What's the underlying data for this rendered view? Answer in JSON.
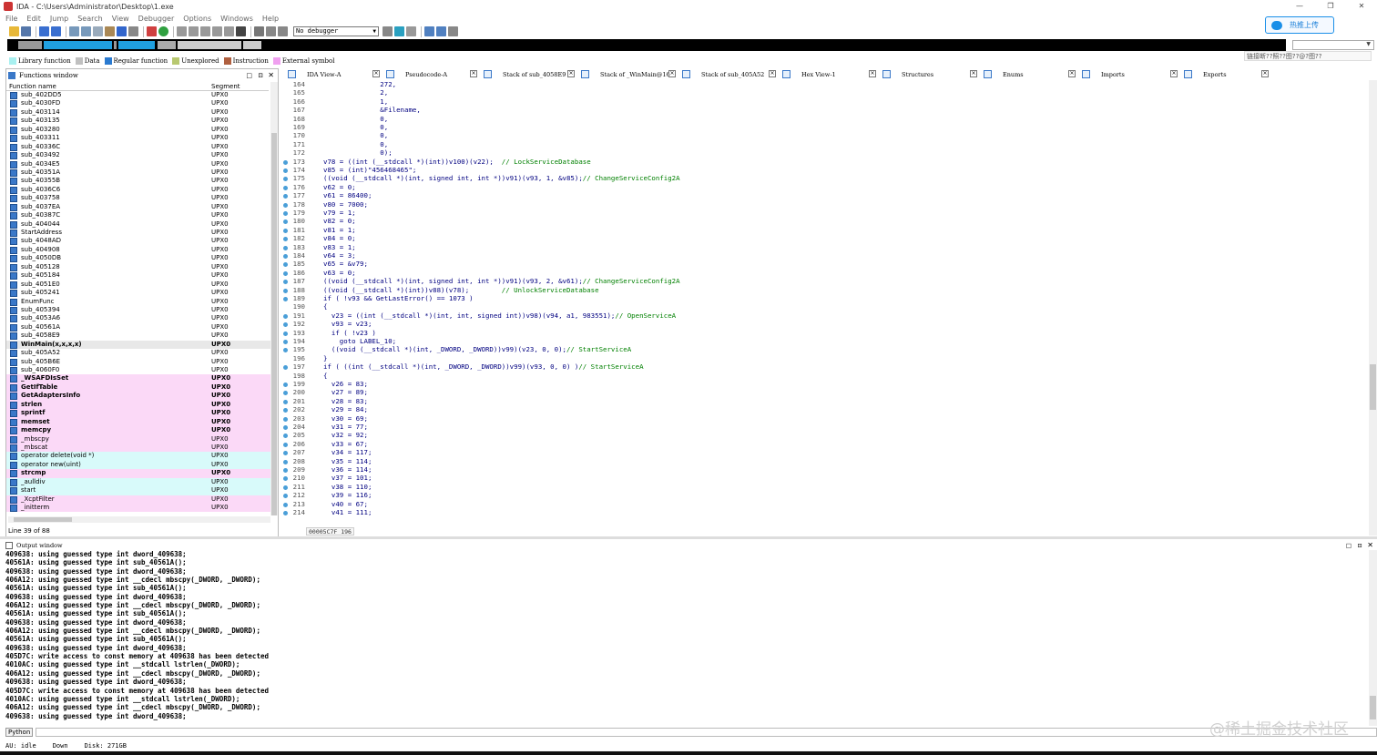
{
  "window": {
    "title": "IDA - C:\\Users\\Administrator\\Desktop\\1.exe"
  },
  "menu": [
    "File",
    "Edit",
    "Jump",
    "Search",
    "View",
    "Debugger",
    "Options",
    "Windows",
    "Help"
  ],
  "toolbar": {
    "debugger_select": "No debugger"
  },
  "upload_button": "热推上传",
  "tooltip": "链接断??照??图??@?图??",
  "legend": [
    {
      "label": "Library function",
      "color": "#a8f0f0"
    },
    {
      "label": "Data",
      "color": "#c0c0c0"
    },
    {
      "label": "Regular function",
      "color": "#2a7ad0"
    },
    {
      "label": "Unexplored",
      "color": "#b8c870"
    },
    {
      "label": "Instruction",
      "color": "#b06040"
    },
    {
      "label": "External symbol",
      "color": "#f0a0f0"
    }
  ],
  "functions_window": {
    "title": "Functions window",
    "col_name": "Function name",
    "col_segment": "Segment",
    "status": "Line 39 of 88",
    "rows": [
      {
        "name": "sub_402DD5",
        "seg": "UPX0",
        "style": ""
      },
      {
        "name": "sub_4030FD",
        "seg": "UPX0",
        "style": ""
      },
      {
        "name": "sub_403114",
        "seg": "UPX0",
        "style": ""
      },
      {
        "name": "sub_403135",
        "seg": "UPX0",
        "style": ""
      },
      {
        "name": "sub_403280",
        "seg": "UPX0",
        "style": ""
      },
      {
        "name": "sub_403311",
        "seg": "UPX0",
        "style": ""
      },
      {
        "name": "sub_40336C",
        "seg": "UPX0",
        "style": ""
      },
      {
        "name": "sub_403492",
        "seg": "UPX0",
        "style": ""
      },
      {
        "name": "sub_4034E5",
        "seg": "UPX0",
        "style": ""
      },
      {
        "name": "sub_40351A",
        "seg": "UPX0",
        "style": ""
      },
      {
        "name": "sub_40355B",
        "seg": "UPX0",
        "style": ""
      },
      {
        "name": "sub_4036C6",
        "seg": "UPX0",
        "style": ""
      },
      {
        "name": "sub_403758",
        "seg": "UPX0",
        "style": ""
      },
      {
        "name": "sub_4037EA",
        "seg": "UPX0",
        "style": ""
      },
      {
        "name": "sub_40387C",
        "seg": "UPX0",
        "style": ""
      },
      {
        "name": "sub_404044",
        "seg": "UPX0",
        "style": ""
      },
      {
        "name": "StartAddress",
        "seg": "UPX0",
        "style": ""
      },
      {
        "name": "sub_4048AD",
        "seg": "UPX0",
        "style": ""
      },
      {
        "name": "sub_404908",
        "seg": "UPX0",
        "style": ""
      },
      {
        "name": "sub_4050DB",
        "seg": "UPX0",
        "style": ""
      },
      {
        "name": "sub_405128",
        "seg": "UPX0",
        "style": ""
      },
      {
        "name": "sub_405184",
        "seg": "UPX0",
        "style": ""
      },
      {
        "name": "sub_4051E0",
        "seg": "UPX0",
        "style": ""
      },
      {
        "name": "sub_405241",
        "seg": "UPX0",
        "style": ""
      },
      {
        "name": "EnumFunc",
        "seg": "UPX0",
        "style": ""
      },
      {
        "name": "sub_405394",
        "seg": "UPX0",
        "style": ""
      },
      {
        "name": "sub_4053A6",
        "seg": "UPX0",
        "style": ""
      },
      {
        "name": "sub_40561A",
        "seg": "UPX0",
        "style": ""
      },
      {
        "name": "sub_4058E9",
        "seg": "UPX0",
        "style": ""
      },
      {
        "name": "WinMain(x,x,x,x)",
        "seg": "UPX0",
        "style": "sel"
      },
      {
        "name": "sub_405A52",
        "seg": "UPX0",
        "style": ""
      },
      {
        "name": "sub_405B6E",
        "seg": "UPX0",
        "style": ""
      },
      {
        "name": "sub_4060F0",
        "seg": "UPX0",
        "style": ""
      },
      {
        "name": "_WSAFDIsSet",
        "seg": "UPX0",
        "style": "pink bold"
      },
      {
        "name": "GetIfTable",
        "seg": "UPX0",
        "style": "pink bold"
      },
      {
        "name": "GetAdaptersInfo",
        "seg": "UPX0",
        "style": "pink bold"
      },
      {
        "name": "strlen",
        "seg": "UPX0",
        "style": "pink bold"
      },
      {
        "name": "sprintf",
        "seg": "UPX0",
        "style": "pink bold"
      },
      {
        "name": "memset",
        "seg": "UPX0",
        "style": "pink bold"
      },
      {
        "name": "memcpy",
        "seg": "UPX0",
        "style": "pink bold"
      },
      {
        "name": "_mbscpy",
        "seg": "UPX0",
        "style": "pink"
      },
      {
        "name": "_mbscat",
        "seg": "UPX0",
        "style": "pink"
      },
      {
        "name": "operator delete(void *)",
        "seg": "UPX0",
        "style": "cyan"
      },
      {
        "name": "operator new(uint)",
        "seg": "UPX0",
        "style": "cyan"
      },
      {
        "name": "strcmp",
        "seg": "UPX0",
        "style": "pink bold"
      },
      {
        "name": "_aulldiv",
        "seg": "UPX0",
        "style": "cyan"
      },
      {
        "name": "start",
        "seg": "UPX0",
        "style": "cyan"
      },
      {
        "name": "_XcptFilter",
        "seg": "UPX0",
        "style": "pink"
      },
      {
        "name": "_initterm",
        "seg": "UPX0",
        "style": "pink"
      }
    ]
  },
  "tabs": [
    {
      "label": "IDA View-A",
      "width": 108
    },
    {
      "label": "Pseudocode-A",
      "width": 107,
      "active": true
    },
    {
      "label": "Stack of sub_4058E9",
      "width": 107
    },
    {
      "label": "Stack of _WinMain@16",
      "width": 111
    },
    {
      "label": "Stack of sub_405A52",
      "width": 110
    },
    {
      "label": "Hex View-1",
      "width": 110
    },
    {
      "label": "Structures",
      "width": 111
    },
    {
      "label": "Enums",
      "width": 108
    },
    {
      "label": "Imports",
      "width": 112
    },
    {
      "label": "Exports",
      "width": 100
    }
  ],
  "code_status": "00005C7F 196",
  "code_lines": [
    {
      "n": "164",
      "dot": false,
      "t": "              272,"
    },
    {
      "n": "165",
      "dot": false,
      "t": "              2,"
    },
    {
      "n": "166",
      "dot": false,
      "t": "              1,"
    },
    {
      "n": "167",
      "dot": false,
      "t": "              &Filename,"
    },
    {
      "n": "168",
      "dot": false,
      "t": "              0,"
    },
    {
      "n": "169",
      "dot": false,
      "t": "              0,"
    },
    {
      "n": "170",
      "dot": false,
      "t": "              0,"
    },
    {
      "n": "171",
      "dot": false,
      "t": "              0,"
    },
    {
      "n": "172",
      "dot": false,
      "t": "              0);"
    },
    {
      "n": "173",
      "dot": true,
      "t": "v78 = ((int (__stdcall *)(int))v100)(v22);  // LockServiceDatabase"
    },
    {
      "n": "174",
      "dot": true,
      "t": "v85 = (int)\"456468465\";"
    },
    {
      "n": "175",
      "dot": true,
      "t": "((void (__stdcall *)(int, signed int, int *))v91)(v93, 1, &v85);// ChangeServiceConfig2A"
    },
    {
      "n": "176",
      "dot": true,
      "t": "v62 = 0;"
    },
    {
      "n": "177",
      "dot": true,
      "t": "v61 = 86400;"
    },
    {
      "n": "178",
      "dot": true,
      "t": "v80 = 7000;"
    },
    {
      "n": "179",
      "dot": true,
      "t": "v79 = 1;"
    },
    {
      "n": "180",
      "dot": true,
      "t": "v82 = 0;"
    },
    {
      "n": "181",
      "dot": true,
      "t": "v81 = 1;"
    },
    {
      "n": "182",
      "dot": true,
      "t": "v84 = 0;"
    },
    {
      "n": "183",
      "dot": true,
      "t": "v83 = 1;"
    },
    {
      "n": "184",
      "dot": true,
      "t": "v64 = 3;"
    },
    {
      "n": "185",
      "dot": true,
      "t": "v65 = &v79;"
    },
    {
      "n": "186",
      "dot": true,
      "t": "v63 = 0;"
    },
    {
      "n": "187",
      "dot": true,
      "t": "((void (__stdcall *)(int, signed int, int *))v91)(v93, 2, &v61);// ChangeServiceConfig2A"
    },
    {
      "n": "188",
      "dot": true,
      "t": "((void (__stdcall *)(int))v88)(v78);        // UnlockServiceDatabase"
    },
    {
      "n": "189",
      "dot": true,
      "t": "if ( !v93 && GetLastError() == 1073 )"
    },
    {
      "n": "190",
      "dot": false,
      "t": "{"
    },
    {
      "n": "191",
      "dot": true,
      "t": "  v23 = ((int (__stdcall *)(int, int, signed int))v98)(v94, a1, 983551);// OpenServiceA"
    },
    {
      "n": "192",
      "dot": true,
      "t": "  v93 = v23;"
    },
    {
      "n": "193",
      "dot": true,
      "t": "  if ( !v23 )"
    },
    {
      "n": "194",
      "dot": true,
      "t": "    goto LABEL_10;"
    },
    {
      "n": "195",
      "dot": true,
      "t": "  ((void (__stdcall *)(int, _DWORD, _DWORD))v99)(v23, 0, 0);// StartServiceA"
    },
    {
      "n": "196",
      "dot": false,
      "t": "}"
    },
    {
      "n": "197",
      "dot": true,
      "t": "if ( ((int (__stdcall *)(int, _DWORD, _DWORD))v99)(v93, 0, 0) )// StartServiceA"
    },
    {
      "n": "198",
      "dot": false,
      "t": "{"
    },
    {
      "n": "199",
      "dot": true,
      "t": "  v26 = 83;"
    },
    {
      "n": "200",
      "dot": true,
      "t": "  v27 = 89;"
    },
    {
      "n": "201",
      "dot": true,
      "t": "  v28 = 83;"
    },
    {
      "n": "202",
      "dot": true,
      "t": "  v29 = 84;"
    },
    {
      "n": "203",
      "dot": true,
      "t": "  v30 = 69;"
    },
    {
      "n": "204",
      "dot": true,
      "t": "  v31 = 77;"
    },
    {
      "n": "205",
      "dot": true,
      "t": "  v32 = 92;"
    },
    {
      "n": "206",
      "dot": true,
      "t": "  v33 = 67;"
    },
    {
      "n": "207",
      "dot": true,
      "t": "  v34 = 117;"
    },
    {
      "n": "208",
      "dot": true,
      "t": "  v35 = 114;"
    },
    {
      "n": "209",
      "dot": true,
      "t": "  v36 = 114;"
    },
    {
      "n": "210",
      "dot": true,
      "t": "  v37 = 101;"
    },
    {
      "n": "211",
      "dot": true,
      "t": "  v38 = 110;"
    },
    {
      "n": "212",
      "dot": true,
      "t": "  v39 = 116;"
    },
    {
      "n": "213",
      "dot": true,
      "t": "  v40 = 67;"
    },
    {
      "n": "214",
      "dot": true,
      "t": "  v41 = 111;"
    }
  ],
  "output_window": {
    "title": "Output window",
    "lines": [
      "409638: using guessed type int dword_409638;",
      "40561A: using guessed type int sub_40561A();",
      "409638: using guessed type int dword_409638;",
      "406A12: using guessed type int __cdecl mbscpy(_DWORD, _DWORD);",
      "40561A: using guessed type int sub_40561A();",
      "409638: using guessed type int dword_409638;",
      "406A12: using guessed type int __cdecl mbscpy(_DWORD, _DWORD);",
      "40561A: using guessed type int sub_40561A();",
      "409638: using guessed type int dword_409638;",
      "406A12: using guessed type int __cdecl mbscpy(_DWORD, _DWORD);",
      "40561A: using guessed type int sub_40561A();",
      "409638: using guessed type int dword_409638;",
      "405D7C: write access to const memory at 409638 has been detected",
      "4010AC: using guessed type int __stdcall lstrlen(_DWORD);",
      "406A12: using guessed type int __cdecl mbscpy(_DWORD, _DWORD);",
      "409638: using guessed type int dword_409638;",
      "405D7C: write access to const memory at 409638 has been detected",
      "4010AC: using guessed type int __stdcall lstrlen(_DWORD);",
      "406A12: using guessed type int __cdecl mbscpy(_DWORD, _DWORD);",
      "409638: using guessed type int dword_409638;"
    ]
  },
  "python_label": "Python",
  "status": {
    "au": "AU:  idle",
    "dir": "Down",
    "disk": "Disk: 271GB"
  },
  "watermark": "@稀土掘金技术社区"
}
